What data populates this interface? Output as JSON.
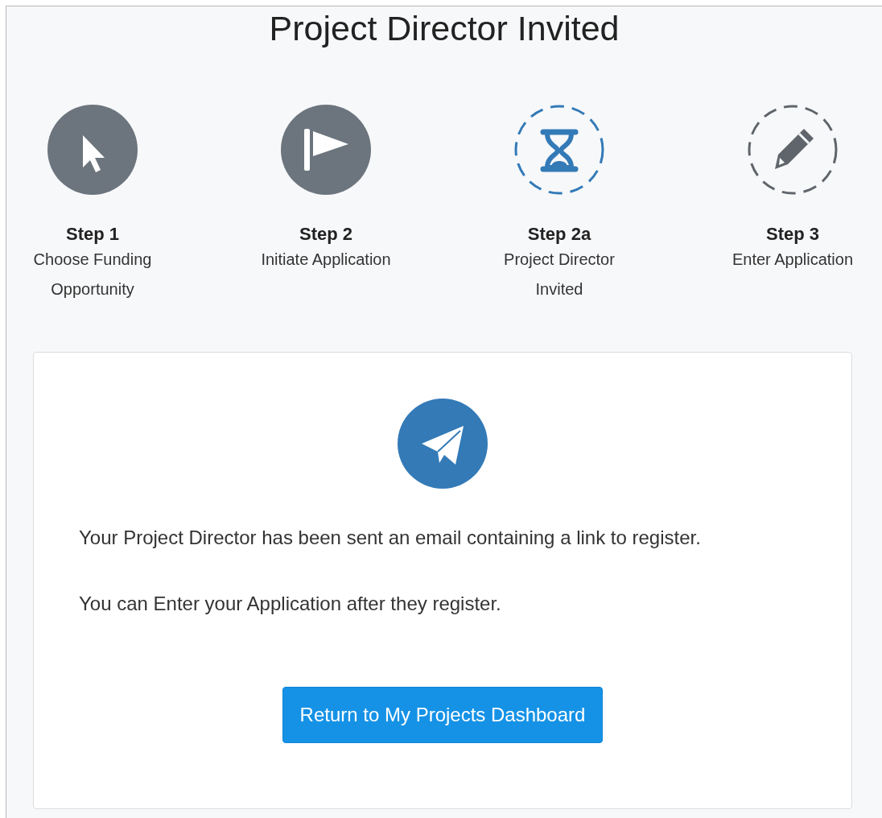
{
  "title": "Project Director Invited",
  "steps": [
    {
      "label": "Step 1",
      "description": "Choose Funding Opportunity",
      "completed": true,
      "selected": false
    },
    {
      "label": "Step 2",
      "description": "Initiate Application",
      "completed": true,
      "selected": false
    },
    {
      "label": "Step 2a",
      "description": "Project Director Invited",
      "completed": false,
      "selected": true
    },
    {
      "label": "Step 3",
      "description": "Enter Application",
      "completed": false,
      "selected": false
    }
  ],
  "message": {
    "lines": [
      "Your Project Director has been sent an email containing a link to register.",
      "You can Enter your Application after they register."
    ],
    "button": "Return to My Projects Dashboard"
  }
}
